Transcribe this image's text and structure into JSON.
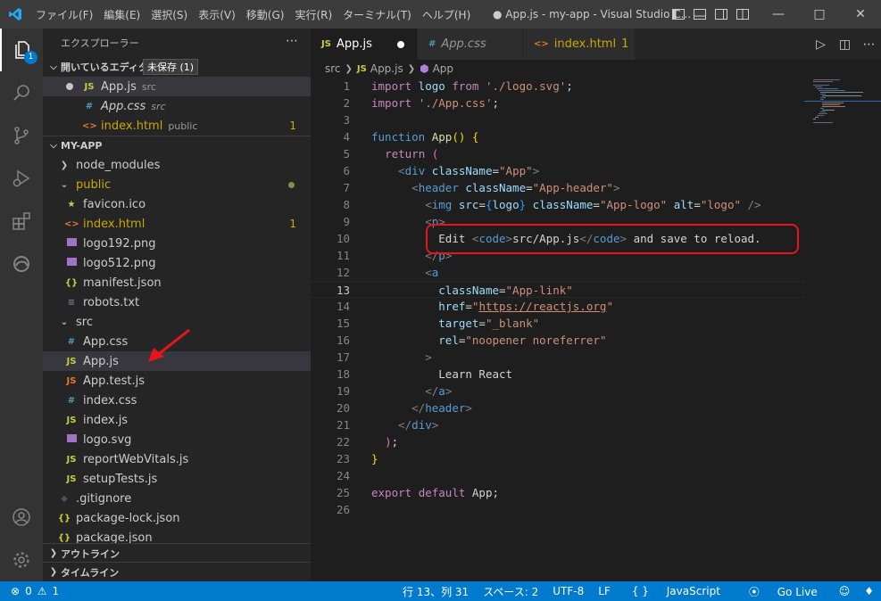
{
  "titlebar": {
    "menu": [
      "ファイル(F)",
      "編集(E)",
      "選択(S)",
      "表示(V)",
      "移動(G)",
      "実行(R)",
      "ターミナル(T)",
      "ヘルプ(H)"
    ],
    "title": "● App.js - my-app - Visual Studio C..."
  },
  "activity": {
    "explorer_badge": "1"
  },
  "sidebar": {
    "title": "エクスプローラー",
    "open_editors": {
      "label": "開いているエディター",
      "tooltip": "未保存 (1)",
      "items": [
        {
          "icon": "JS",
          "name": "App.js",
          "desc": "src"
        },
        {
          "icon": "#",
          "name": "App.css",
          "desc": "src"
        },
        {
          "icon": "<>",
          "name": "index.html",
          "desc": "public",
          "count": "1"
        }
      ]
    },
    "project": {
      "label": "MY-APP",
      "items": [
        {
          "name": "node_modules"
        },
        {
          "name": "public"
        },
        {
          "name": "favicon.ico"
        },
        {
          "name": "index.html",
          "count": "1"
        },
        {
          "name": "logo192.png"
        },
        {
          "name": "logo512.png"
        },
        {
          "name": "manifest.json",
          "icon": "{}"
        },
        {
          "name": "robots.txt"
        },
        {
          "name": "src"
        },
        {
          "name": "App.css",
          "icon": "#"
        },
        {
          "name": "App.js",
          "icon": "JS"
        },
        {
          "name": "App.test.js",
          "icon": "JS"
        },
        {
          "name": "index.css",
          "icon": "#"
        },
        {
          "name": "index.js",
          "icon": "JS"
        },
        {
          "name": "logo.svg"
        },
        {
          "name": "reportWebVitals.js",
          "icon": "JS"
        },
        {
          "name": "setupTests.js",
          "icon": "JS"
        },
        {
          "name": ".gitignore"
        },
        {
          "name": "package-lock.json",
          "icon": "{}"
        },
        {
          "name": "package.json",
          "icon": "{}"
        }
      ]
    },
    "outline": "アウトライン",
    "timeline": "タイムライン"
  },
  "tabs": [
    {
      "icon": "JS",
      "name": "App.js"
    },
    {
      "icon": "#",
      "name": "App.css"
    },
    {
      "icon": "<>",
      "name": "index.html",
      "count": "1"
    }
  ],
  "breadcrumb": {
    "folder": "src",
    "file": "App.js",
    "symbol": "App"
  },
  "editor": {
    "line_numbers": [
      "1",
      "2",
      "3",
      "4",
      "5",
      "6",
      "7",
      "8",
      "9",
      "10",
      "11",
      "12",
      "13",
      "14",
      "15",
      "16",
      "17",
      "18",
      "19",
      "20",
      "21",
      "22",
      "23",
      "24",
      "25",
      "26"
    ],
    "l1": [
      "import",
      " logo ",
      "from",
      " ",
      "'./logo.svg'",
      ";"
    ],
    "l2": [
      "import",
      " ",
      "'./App.css'",
      ";"
    ],
    "l4": [
      "function",
      " ",
      "App",
      "(",
      ")",
      " ",
      "{"
    ],
    "l5": [
      "return",
      " ",
      "("
    ],
    "l6": [
      "<",
      "div",
      " ",
      "className",
      "=",
      "\"App\"",
      ">"
    ],
    "l7": [
      "<",
      "header",
      " ",
      "className",
      "=",
      "\"App-header\"",
      ">"
    ],
    "l8": [
      "<",
      "img",
      " ",
      "src",
      "=",
      "{",
      "logo",
      "}",
      " ",
      "className",
      "=",
      "\"App-logo\"",
      " ",
      "alt",
      "=",
      "\"logo\"",
      " ",
      "/>"
    ],
    "l9": [
      "<",
      "p",
      ">"
    ],
    "l10": [
      "Edit ",
      "<",
      "code",
      ">",
      "src/App.js",
      "</",
      "code",
      ">",
      " and save to reload."
    ],
    "l11": [
      "</",
      "p",
      ">"
    ],
    "l12": [
      "<",
      "a"
    ],
    "l13": [
      "className",
      "=",
      "\"App-link\""
    ],
    "l14": [
      "href",
      "=",
      "\"",
      "https://reactjs.org",
      "\""
    ],
    "l15": [
      "target",
      "=",
      "\"_blank\""
    ],
    "l16": [
      "rel",
      "=",
      "\"noopener noreferrer\""
    ],
    "l17": [
      ">"
    ],
    "l18": [
      "Learn React"
    ],
    "l19": [
      "</",
      "a",
      ">"
    ],
    "l20": [
      "</",
      "header",
      ">"
    ],
    "l21": [
      "</",
      "div",
      ">"
    ],
    "l22": [
      ")",
      ";"
    ],
    "l23": [
      "}"
    ],
    "l25": [
      "export",
      " ",
      "default",
      " App;"
    ]
  },
  "status": {
    "errors": "0",
    "warnings": "1",
    "position": "行 13、列 31",
    "spaces": "スペース: 2",
    "encoding": "UTF-8",
    "eol": "LF",
    "language": "JavaScript",
    "golive": "Go Live"
  },
  "colors": {
    "accent": "#007acc",
    "annotation": "#e8141c"
  }
}
